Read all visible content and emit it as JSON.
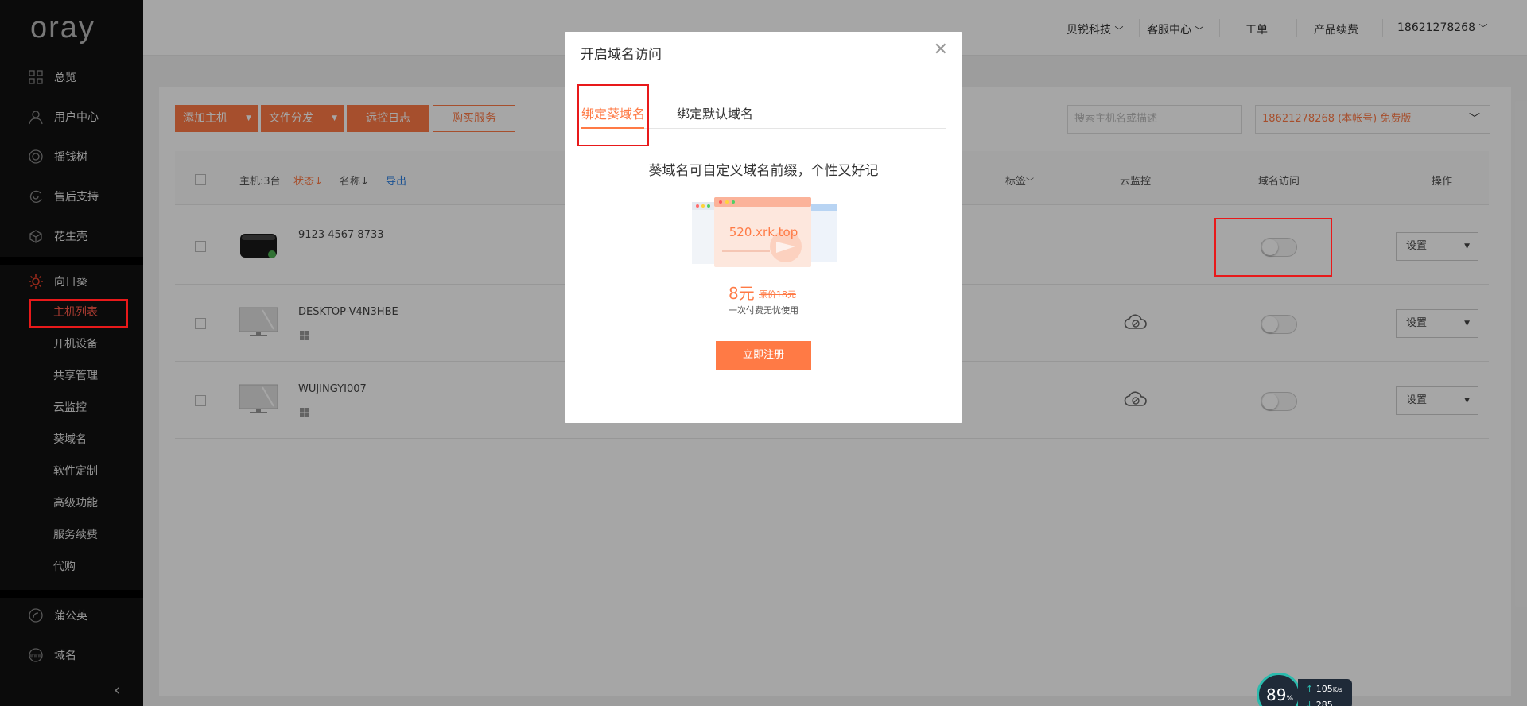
{
  "sidebar": {
    "logo": "oray",
    "items": [
      {
        "label": "总览",
        "icon": "grid-icon"
      },
      {
        "label": "用户中心",
        "icon": "user-icon"
      },
      {
        "label": "摇钱树",
        "icon": "target-icon"
      },
      {
        "label": "售后支持",
        "icon": "support-icon"
      },
      {
        "label": "花生壳",
        "icon": "peanut-icon"
      },
      {
        "label": "向日葵",
        "icon": "sunflower-icon"
      }
    ],
    "sub_items": [
      "主机列表",
      "开机设备",
      "共享管理",
      "云监控",
      "葵域名",
      "软件定制",
      "高级功能",
      "服务续费",
      "代购"
    ],
    "bottom_items": [
      {
        "label": "蒲公英",
        "icon": "dandelion-icon"
      },
      {
        "label": "域名",
        "icon": "www-icon"
      }
    ]
  },
  "topbar": {
    "links": [
      "贝锐科技",
      "客服中心",
      "工单",
      "产品续费",
      "18621278268"
    ]
  },
  "toolbar": {
    "add_host": "添加主机",
    "file_dist": "文件分发",
    "remote_log": "远控日志",
    "buy_service": "购买服务",
    "search_placeholder": "搜索主机名或描述",
    "account": "18621278268 (本帐号) 免费版"
  },
  "table": {
    "host_count": "主机:3台",
    "col_status": "状态↓",
    "col_name": "名称↓",
    "col_export": "导出",
    "col_tag": "标签",
    "col_cloud": "云监控",
    "col_domain": "域名访问",
    "col_action": "操作",
    "rows": [
      {
        "name": "9123 4567 8733",
        "action": "设置"
      },
      {
        "name": "DESKTOP-V4N3HBE",
        "action": "设置"
      },
      {
        "name": "WUJINGYI007",
        "action": "设置"
      }
    ]
  },
  "modal": {
    "title": "开启域名访问",
    "tab1": "绑定葵域名",
    "tab2": "绑定默认域名",
    "slogan": "葵域名可自定义域名前缀，个性又好记",
    "sample_domain": "520.xrk.top",
    "price": "8元",
    "original_price": "原价18元",
    "price_desc": "一次付费无忧使用",
    "register": "立即注册"
  },
  "widget": {
    "percent": "89",
    "percent_unit": "%",
    "up_speed": "105",
    "up_unit": "K/s",
    "down_speed": "285"
  },
  "colors": {
    "accent": "#ff7a45",
    "highlight": "#e8191a",
    "sidebar": "#111111"
  }
}
